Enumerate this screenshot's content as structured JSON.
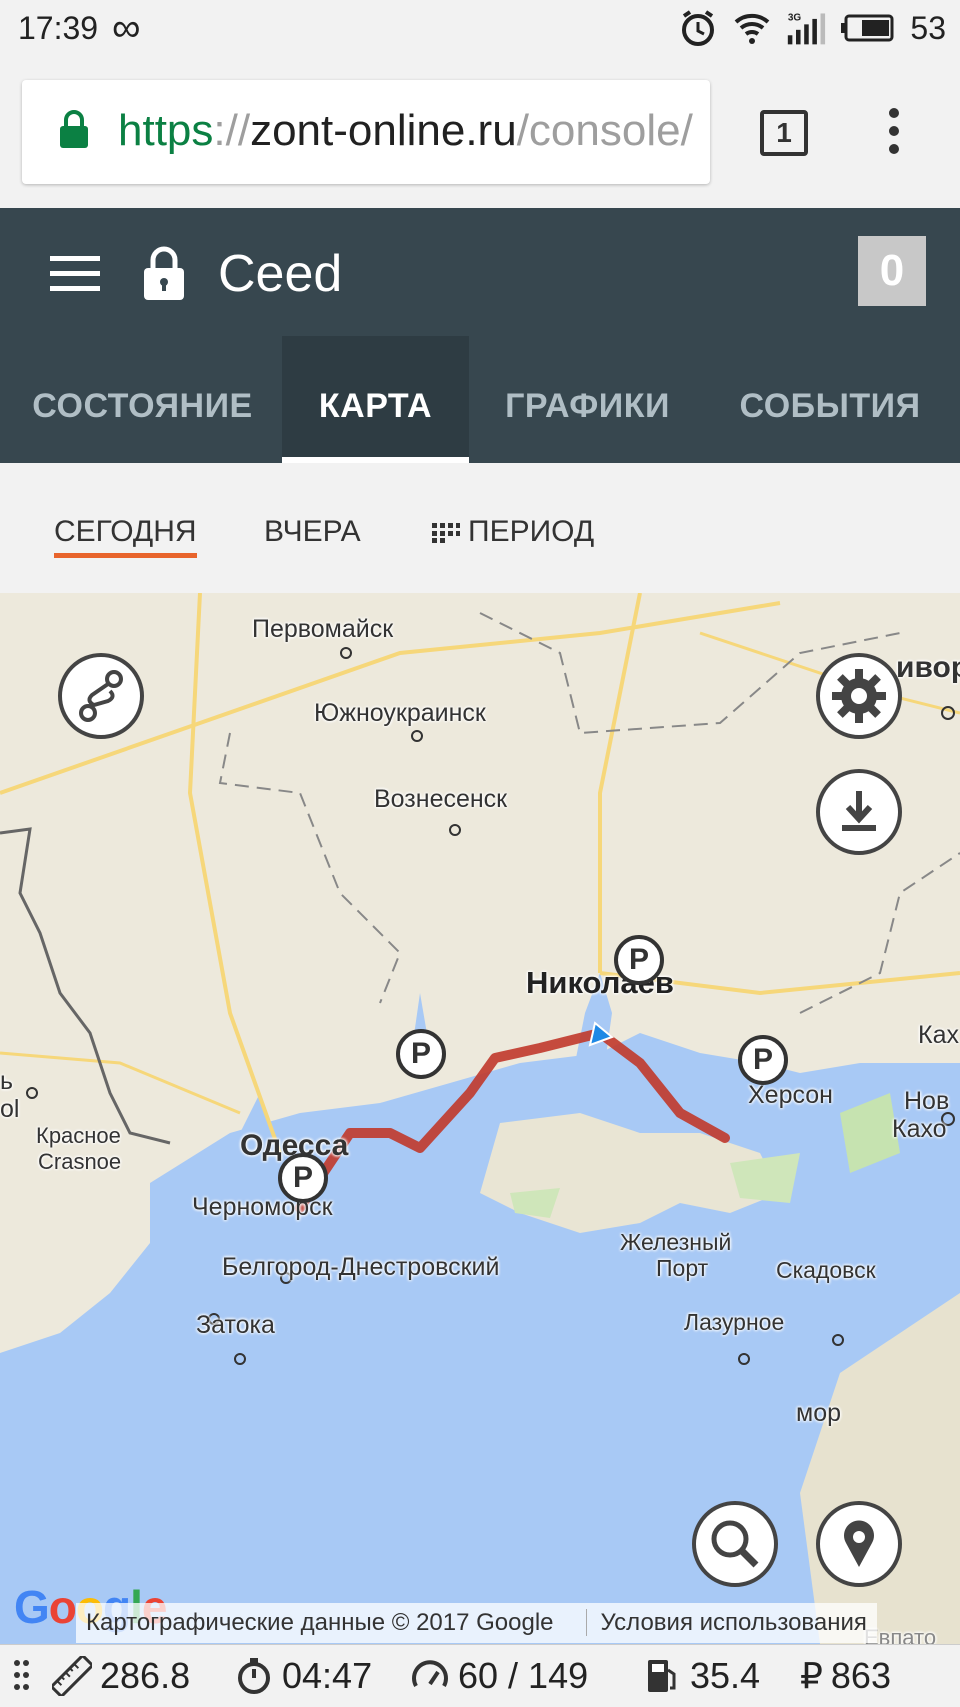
{
  "status_bar": {
    "time": "17:39",
    "infinity_symbol": "∞",
    "icons": [
      "alarm-icon",
      "wifi-icon",
      "signal-3g-icon",
      "battery-icon"
    ],
    "network_label": "3G",
    "battery_percent": "53"
  },
  "browser": {
    "url_scheme": "https",
    "url_separator": "://",
    "url_host": "zont-online.ru",
    "url_path": "/console/",
    "tab_count": "1",
    "secure_color": "#0b8043"
  },
  "app": {
    "title": "Ceed",
    "badge_count": "0",
    "header_color": "#37474f",
    "tabs": [
      {
        "label": "СОСТОЯНИЕ",
        "active": false
      },
      {
        "label": "КАРТА",
        "active": true
      },
      {
        "label": "ГРАФИКИ",
        "active": false
      },
      {
        "label": "СОБЫТИЯ",
        "active": false
      }
    ]
  },
  "subtabs": {
    "today": "СЕГОДНЯ",
    "yesterday": "ВЧЕРА",
    "period": "ПЕРИОД",
    "accent_color": "#e8642c"
  },
  "map": {
    "cities": {
      "pervomaisk": "Первомайск",
      "yuzhnoukrainsk": "Южноукраинск",
      "voznesensk": "Вознесенск",
      "nikolaev": "Николаев",
      "odessa": "Одесса",
      "chernomorsk": "Черноморск",
      "belgorod": "Белгород-Днестровский",
      "zatoka": "Затока",
      "krasnoe": "Красное",
      "crasnoe": "Crasnoe",
      "zheleznyi_port_1": "Железный",
      "zheleznyi_port_2": "Порт",
      "skadovsk": "Скадовск",
      "lazurnoe": "Лазурное",
      "kherson": "Херсон",
      "nova_kakhovka_1": "Нов",
      "nova_kakhovka_2": "Кахо",
      "kakh": "Ках",
      "krivoy": "ивор",
      "evpatoria": "Евпато",
      "edge_b": "ь",
      "edge_ol": "ol",
      "mor": "мор"
    },
    "parking_marker_label": "P",
    "route_color": "#c0392b",
    "attribution": "Картографические данные © 2017 Google",
    "terms": "Условия использования",
    "google_logo_letters": [
      "G",
      "o",
      "o",
      "g",
      "l",
      "e"
    ],
    "buttons": [
      "route-icon",
      "gear-icon",
      "download-icon",
      "search-icon",
      "location-pin-icon"
    ]
  },
  "stats": {
    "distance": "286.8",
    "duration": "04:47",
    "speed": "60 / 149",
    "fuel": "35.4",
    "currency": "₽",
    "cost": "863"
  }
}
